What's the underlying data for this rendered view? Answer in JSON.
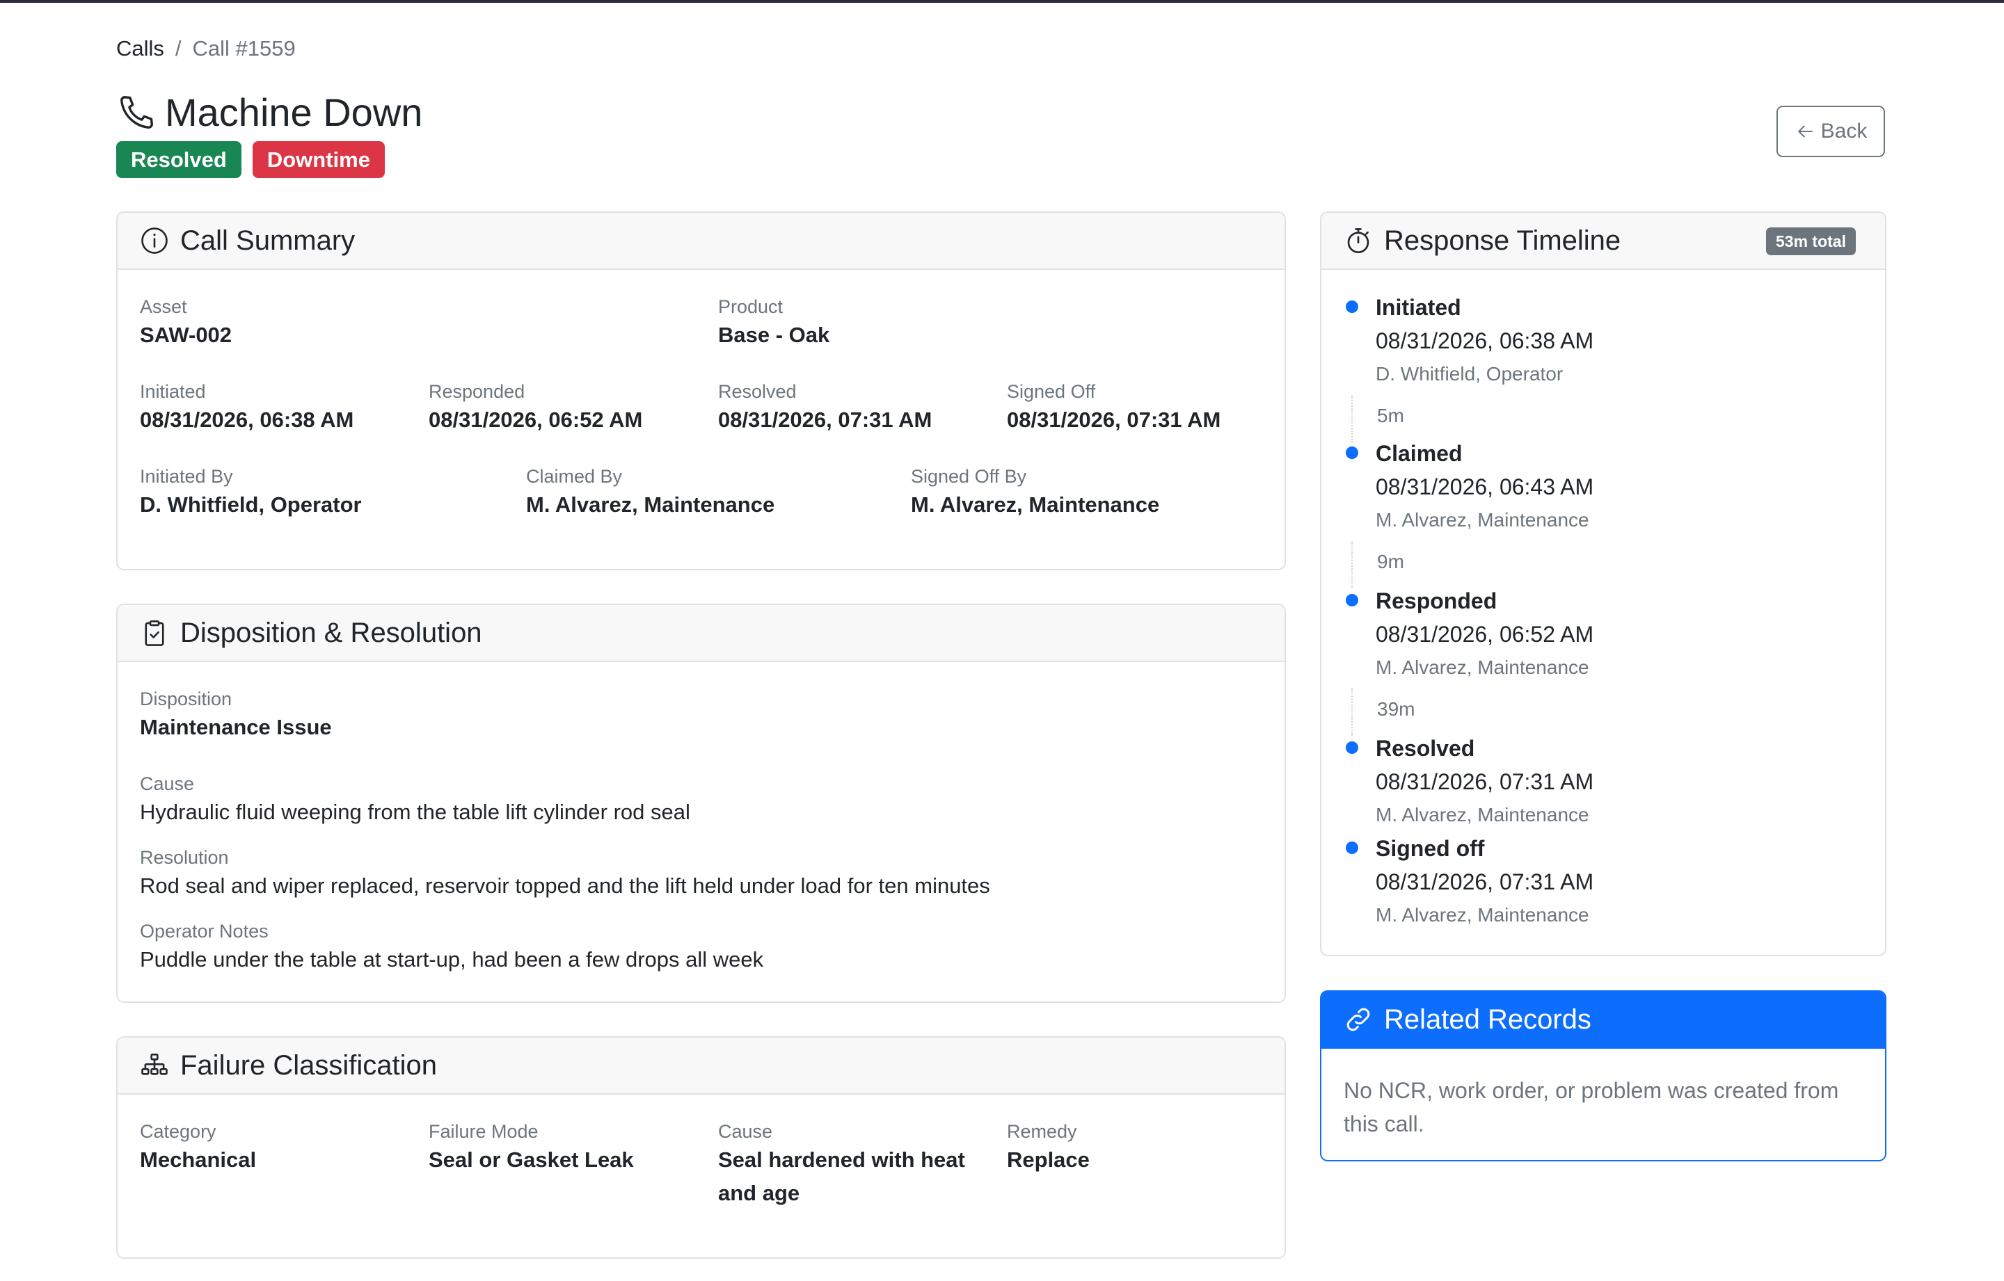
{
  "breadcrumb": {
    "parent": "Calls",
    "current": "Call #1559"
  },
  "page": {
    "title": "Machine Down",
    "status_badge": "Resolved",
    "type_badge": "Downtime",
    "back_label": "Back"
  },
  "summary": {
    "title": "Call Summary",
    "asset_label": "Asset",
    "asset": "SAW-002",
    "product_label": "Product",
    "product": "Base - Oak",
    "initiated_label": "Initiated",
    "initiated": "08/31/2026, 06:38 AM",
    "responded_label": "Responded",
    "responded": "08/31/2026, 06:52 AM",
    "resolved_label": "Resolved",
    "resolved": "08/31/2026, 07:31 AM",
    "signed_off_label": "Signed Off",
    "signed_off": "08/31/2026, 07:31 AM",
    "initiated_by_label": "Initiated By",
    "initiated_by": "D. Whitfield, Operator",
    "claimed_by_label": "Claimed By",
    "claimed_by": "M. Alvarez, Maintenance",
    "signed_off_by_label": "Signed Off By",
    "signed_off_by": "M. Alvarez, Maintenance"
  },
  "disposition": {
    "title": "Disposition & Resolution",
    "disposition_label": "Disposition",
    "disposition": "Maintenance Issue",
    "cause_label": "Cause",
    "cause": "Hydraulic fluid weeping from the table lift cylinder rod seal",
    "resolution_label": "Resolution",
    "resolution": "Rod seal and wiper replaced, reservoir topped and the lift held under load for ten minutes",
    "notes_label": "Operator Notes",
    "notes": "Puddle under the table at start-up, had been a few drops all week"
  },
  "failure": {
    "title": "Failure Classification",
    "category_label": "Category",
    "category": "Mechanical",
    "mode_label": "Failure Mode",
    "mode": "Seal or Gasket Leak",
    "cause_label": "Cause",
    "cause_line1": "Seal hardened with heat",
    "cause_line2": "and age",
    "remedy_label": "Remedy",
    "remedy": "Replace"
  },
  "timeline": {
    "title": "Response Timeline",
    "total": "53m total",
    "events": [
      {
        "name": "Initiated",
        "time": "08/31/2026, 06:38 AM",
        "who": "D. Whitfield, Operator"
      },
      {
        "name": "Claimed",
        "time": "08/31/2026, 06:43 AM",
        "who": "M. Alvarez, Maintenance"
      },
      {
        "name": "Responded",
        "time": "08/31/2026, 06:52 AM",
        "who": "M. Alvarez, Maintenance"
      },
      {
        "name": "Resolved",
        "time": "08/31/2026, 07:31 AM",
        "who": "M. Alvarez, Maintenance"
      },
      {
        "name": "Signed off",
        "time": "08/31/2026, 07:31 AM",
        "who": "M. Alvarez, Maintenance"
      }
    ],
    "gaps": [
      "5m",
      "9m",
      "39m"
    ]
  },
  "related": {
    "title": "Related Records",
    "line1": "No NCR, work order, or problem was created from",
    "line2": "this call."
  },
  "colors": {
    "accent": "#0d6efd",
    "success": "#198754",
    "danger": "#dc3545",
    "muted": "#6c757d"
  }
}
